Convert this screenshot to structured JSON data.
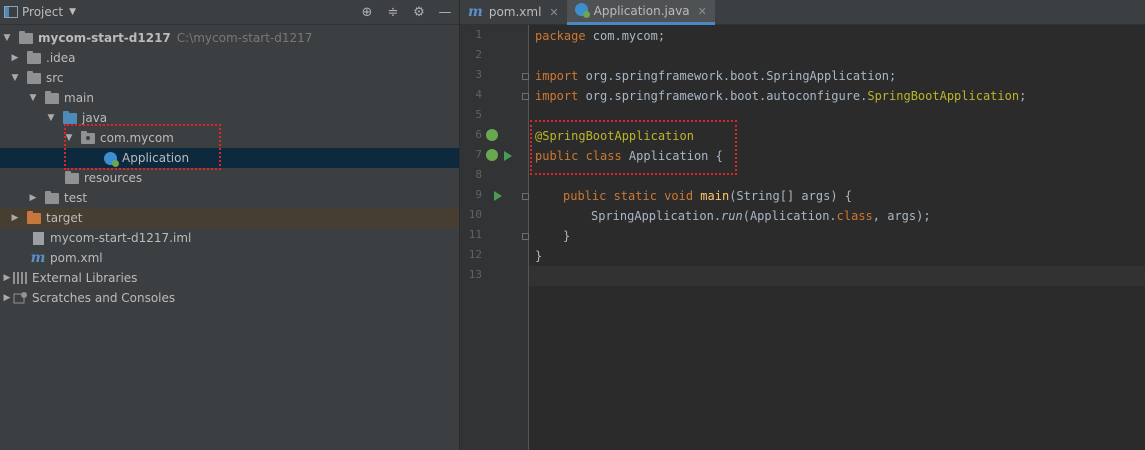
{
  "project_panel": {
    "title": "Project",
    "tools": [
      "crosshair-icon",
      "collapse-icon",
      "gear-icon",
      "minimize-icon"
    ],
    "tree": [
      {
        "label": "mycom-start-d1217",
        "path": "C:\\mycom-start-d1217"
      },
      {
        "label": ".idea"
      },
      {
        "label": "src"
      },
      {
        "label": "main"
      },
      {
        "label": "java"
      },
      {
        "label": "com.mycom"
      },
      {
        "label": "Application"
      },
      {
        "label": "resources"
      },
      {
        "label": "test"
      },
      {
        "label": "target"
      },
      {
        "label": "mycom-start-d1217.iml"
      },
      {
        "label": "pom.xml"
      },
      {
        "label": "External Libraries"
      },
      {
        "label": "Scratches and Consoles"
      }
    ]
  },
  "editor": {
    "tabs": [
      {
        "label": "pom.xml",
        "icon": "maven-icon"
      },
      {
        "label": "Application.java",
        "icon": "spring-class-icon",
        "active": true
      }
    ],
    "line_numbers": [
      "1",
      "2",
      "3",
      "4",
      "5",
      "6",
      "7",
      "8",
      "9",
      "10",
      "11",
      "12",
      "13"
    ],
    "code": {
      "l1_kw": "package",
      "l1_rest": " com.mycom;",
      "l3_kw": "import",
      "l3_rest": " org.springframework.boot.SpringApplication;",
      "l4_kw": "import",
      "l4_rest": " org.springframework.boot.autoconfigure.",
      "l4_ann": "SpringBootApplication",
      "l4_end": ";",
      "l6_ann": "@SpringBootApplication",
      "l7_kw": "public class",
      "l7_rest": " Application {",
      "l9_kw": "public static void",
      "l9_fn": "main",
      "l9_rest": "(String[] args) {",
      "l10_a": "SpringApplication.",
      "l10_it": "run",
      "l10_b": "(Application.",
      "l10_kw": "class",
      "l10_c": ", args);",
      "l11": "}",
      "l12": "}"
    }
  },
  "colors": {
    "highlight_box": "#e0242a",
    "selection": "#0d293e"
  }
}
